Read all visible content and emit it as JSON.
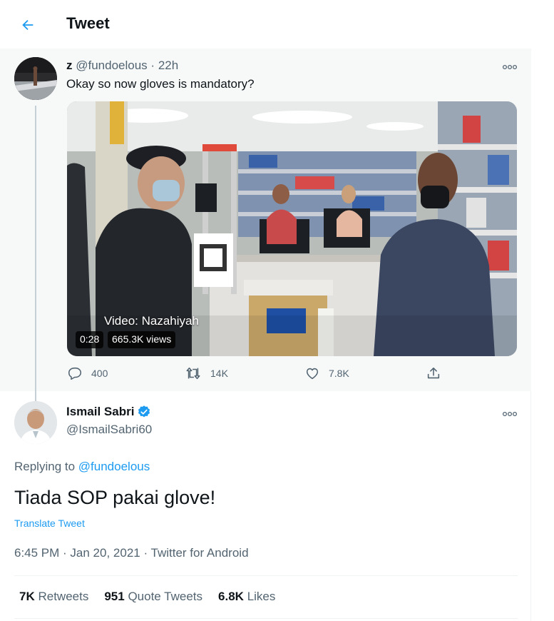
{
  "header": {
    "title": "Tweet"
  },
  "parent_tweet": {
    "name": "z",
    "handle": "@fundoelous",
    "separator": "·",
    "time": "22h",
    "text": "Okay so now gloves is mandatory?",
    "video": {
      "credit": "Video: Nazahiyah",
      "duration": "0:28",
      "views": "665.3K views"
    },
    "replies": "400",
    "retweets": "14K",
    "likes": "7.8K"
  },
  "main_tweet": {
    "name": "Ismail Sabri",
    "handle": "@IsmailSabri60",
    "replying_prefix": "Replying to",
    "replying_to": "@fundoelous",
    "text": "Tiada SOP pakai glove!",
    "translate": "Translate Tweet",
    "timestamp": "6:45 PM · Jan 20, 2021 · Twitter for Android",
    "stats": {
      "retweets_count": "7K",
      "retweets_label": "Retweets",
      "quotes_count": "951",
      "quotes_label": "Quote Tweets",
      "likes_count": "6.8K",
      "likes_label": "Likes"
    }
  },
  "colors": {
    "accent": "#1d9bf0",
    "text_primary": "#0f1419",
    "text_secondary": "#536471",
    "highlight_bg": "#f7f9f9"
  },
  "icons": {
    "back": "arrow-left-icon",
    "more": "more-icon",
    "reply": "reply-icon",
    "retweet": "retweet-icon",
    "like": "heart-icon",
    "share": "share-icon",
    "verified": "verified-badge-icon"
  }
}
